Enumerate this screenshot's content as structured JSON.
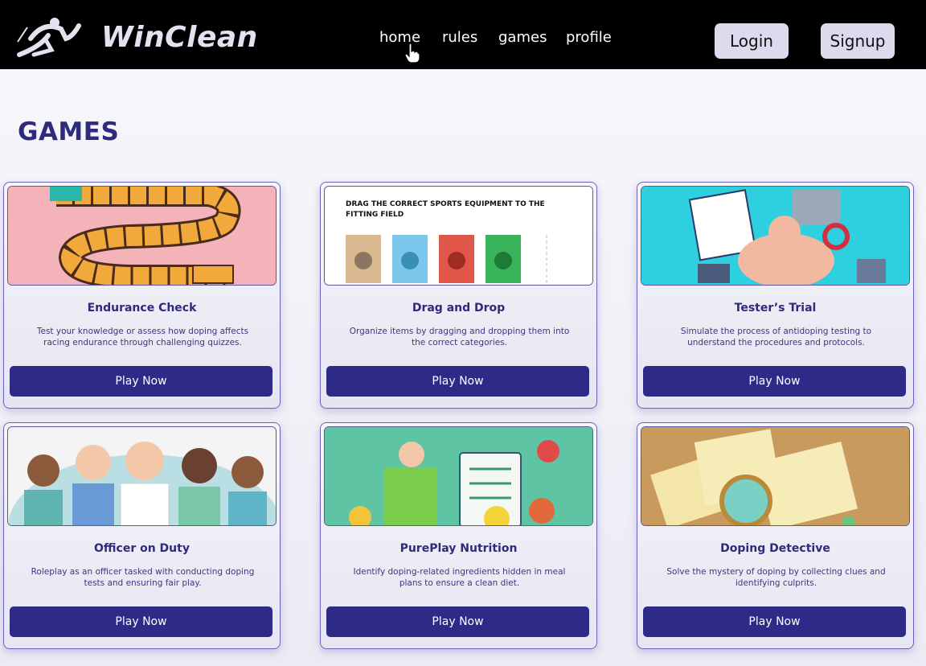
{
  "brand": {
    "name": "WinClean"
  },
  "nav": {
    "home": "home",
    "rules": "rules",
    "games": "games",
    "profile": "profile"
  },
  "auth": {
    "login": "Login",
    "signup": "Signup"
  },
  "page": {
    "title": "GAMES"
  },
  "colors": {
    "accent": "#2e2a88",
    "heading": "#2e2a7c",
    "navbar": "#000000",
    "auth_button_bg": "#dcdbed"
  },
  "games": [
    {
      "title": "Endurance Check",
      "description": "Test your knowledge or assess how doping affects racing endurance through challenging quizzes.",
      "button": "Play Now",
      "image": "board-game-track"
    },
    {
      "title": "Drag and Drop",
      "description": "Organize items by dragging and dropping them into the correct categories.",
      "button": "Play Now",
      "image": "sports-fields",
      "image_caption": "DRAG THE CORRECT SPORTS EQUIPMENT TO THE FITTING FIELD"
    },
    {
      "title": "Tester’s Trial",
      "description": "Simulate the process of antidoping testing to understand the procedures and protocols.",
      "button": "Play Now",
      "image": "medical-lab"
    },
    {
      "title": "Officer on Duty",
      "description": "Roleplay as an officer tasked with conducting doping tests and ensuring fair play.",
      "button": "Play Now",
      "image": "medical-staff"
    },
    {
      "title": "PurePlay Nutrition",
      "description": "Identify doping-related ingredients hidden in meal plans to ensure a clean diet.",
      "button": "Play Now",
      "image": "nutrition-checklist"
    },
    {
      "title": "Doping Detective",
      "description": "Solve the mystery of doping by collecting clues and identifying culprits.",
      "button": "Play Now",
      "image": "detective-files"
    }
  ]
}
